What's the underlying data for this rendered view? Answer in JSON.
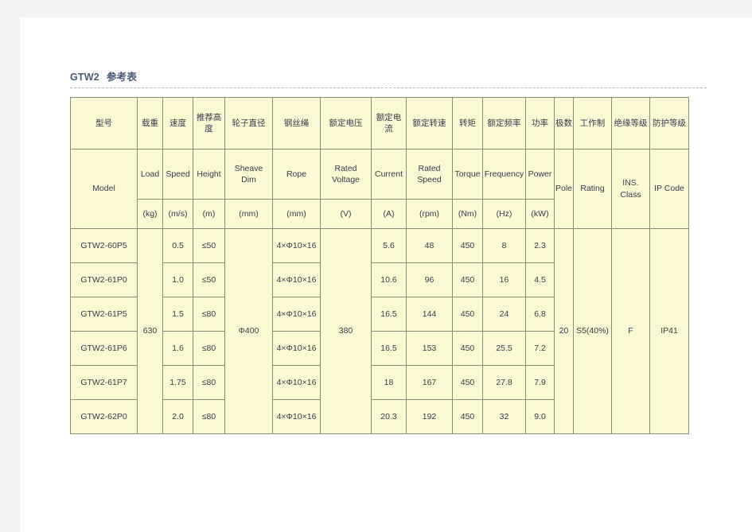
{
  "page": {
    "title_model": "GTW2",
    "title_cn": "参考表"
  },
  "table": {
    "columns_cn": [
      "型号",
      "载重",
      "速度",
      "推荐高度",
      "轮子直径",
      "钢丝绳",
      "额定电压",
      "额定电流",
      "额定转速",
      "转矩",
      "额定频率",
      "功率",
      "极数",
      "工作制",
      "绝缘等级",
      "防护等级"
    ],
    "columns_en": [
      "Model",
      "Load",
      "Speed",
      "Height",
      "Sheave Dim",
      "Rope",
      "Rated Voltage",
      "Current",
      "Rated Speed",
      "Torque",
      "Frequency",
      "Power",
      "Pole",
      "Rating",
      "INS. Class",
      "IP Code"
    ],
    "columns_en_line1": [
      "Model",
      "Load",
      "Speed",
      "Height",
      "Sheave",
      "Rope",
      "Rated",
      "Current",
      "Rated",
      "Torque",
      "Frequency",
      "Power",
      "Pole",
      "Rating",
      "INS.",
      "IP Code"
    ],
    "columns_en_line2": [
      "",
      "",
      "",
      "",
      "Dim",
      "",
      "Voltage",
      "",
      "Speed",
      "",
      "",
      "",
      "",
      "",
      "Class",
      ""
    ],
    "units": [
      "",
      "(kg)",
      "(m/s)",
      "(m)",
      "(mm)",
      "(mm)",
      "(V)",
      "(A)",
      "(rpm)",
      "(Nm)",
      "(Hz)",
      "(kW)",
      "",
      "",
      "",
      ""
    ],
    "merged": {
      "load": "630",
      "sheave_dim": "Φ400",
      "rated_voltage": "380",
      "pole": "20",
      "rating": "S5(40%)",
      "ins_class": "F",
      "ip_code": "IP41"
    },
    "rows": [
      {
        "model": "GTW2-60P5",
        "speed": "0.5",
        "height": "≤50",
        "rope": "4×Φ10×16",
        "current": "5.6",
        "rated_speed": "48",
        "torque": "450",
        "frequency": "8",
        "power": "2.3"
      },
      {
        "model": "GTW2-61P0",
        "speed": "1.0",
        "height": "≤50",
        "rope": "4×Φ10×16",
        "current": "10.6",
        "rated_speed": "96",
        "torque": "450",
        "frequency": "16",
        "power": "4.5"
      },
      {
        "model": "GTW2-61P5",
        "speed": "1.5",
        "height": "≤80",
        "rope": "4×Φ10×16",
        "current": "16.5",
        "rated_speed": "144",
        "torque": "450",
        "frequency": "24",
        "power": "6.8"
      },
      {
        "model": "GTW2-61P6",
        "speed": "1.6",
        "height": "≤80",
        "rope": "4×Φ10×16",
        "current": "16.5",
        "rated_speed": "153",
        "torque": "450",
        "frequency": "25.5",
        "power": "7.2"
      },
      {
        "model": "GTW2-61P7",
        "speed": "1.75",
        "height": "≤80",
        "rope": "4×Φ10×16",
        "current": "18",
        "rated_speed": "167",
        "torque": "450",
        "frequency": "27.8",
        "power": "7.9"
      },
      {
        "model": "GTW2-62P0",
        "speed": "2.0",
        "height": "≤80",
        "rope": "4×Φ10×16",
        "current": "20.3",
        "rated_speed": "192",
        "torque": "450",
        "frequency": "32",
        "power": "9.0"
      }
    ]
  },
  "colors": {
    "table_bg": "#fbf8d4",
    "table_border": "#8a8a7a",
    "title_text": "#4a5a73",
    "text": "#3a3a4a",
    "page_bg": "#ffffff",
    "canvas_bg": "#f4f4f4"
  }
}
